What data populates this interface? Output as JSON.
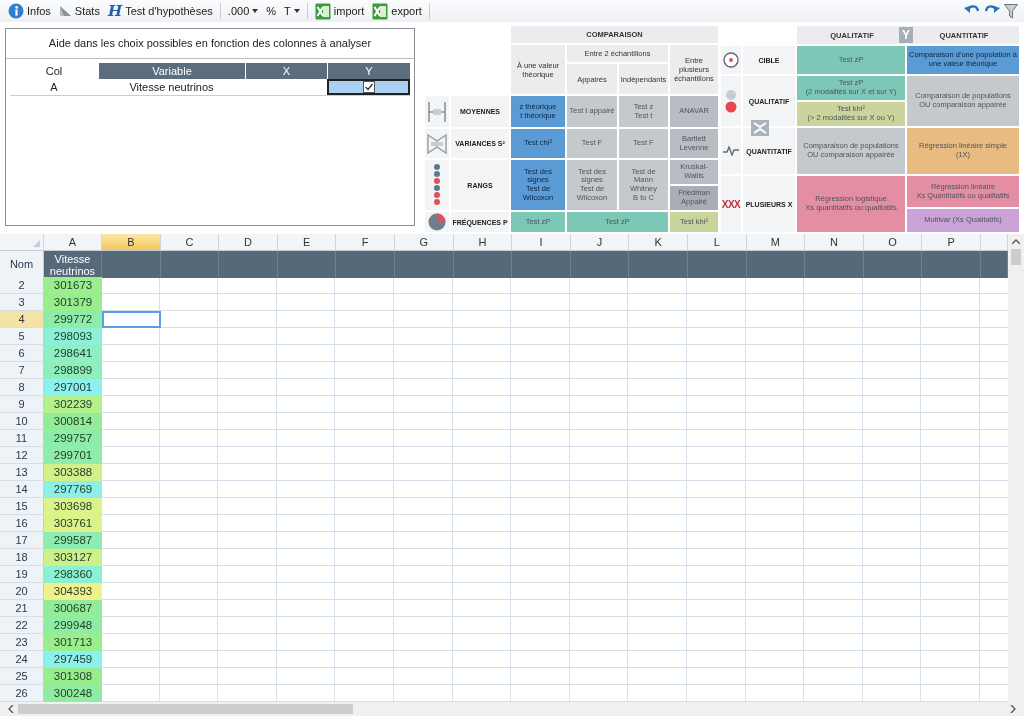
{
  "toolbar": {
    "groups": [
      {
        "items": [
          {
            "kind": "info",
            "label": "Infos"
          },
          {
            "kind": "stats",
            "label": "Stats"
          },
          {
            "kind": "hypothesis",
            "icon": "H",
            "label": "Test d'hypothèses"
          }
        ]
      },
      {
        "items": [
          {
            "kind": "dropdown",
            "label": ".000"
          },
          {
            "kind": "plain",
            "label": "%"
          },
          {
            "kind": "dropdown",
            "label": "T"
          }
        ]
      },
      {
        "items": [
          {
            "kind": "excel",
            "label": "import"
          },
          {
            "kind": "excel",
            "label": "export"
          }
        ]
      }
    ]
  },
  "help_panel": {
    "title": "Aide dans les choix possibles en fonction des colonnes à analyser",
    "columns": [
      "Col",
      "Variable",
      "X",
      "Y"
    ],
    "rows": [
      {
        "col": "A",
        "variable": "Vitesse neutrinos",
        "y_checked": true
      }
    ]
  },
  "comparison": {
    "title": "COMPARAISON",
    "single": "À une valeur\nthéorique",
    "two": "Entre 2 échantillons",
    "paired": "Appairés",
    "independent": "Indépendants",
    "several": "Entre\nplusieurs\néchantillons",
    "rows": [
      {
        "kind": "means",
        "label": "MOYENNES",
        "cells": [
          {
            "text": "z théorique\nt théorique",
            "color": "#5b9bd5",
            "active": true
          },
          {
            "text": "Test t appairé",
            "color": "#c5c8cd",
            "active": false
          },
          {
            "text": "Test z\nTest t",
            "color": "#c5c8cd",
            "active": false
          },
          {
            "text": "ANAVAR",
            "color": "#b9bdc3",
            "active": false
          }
        ]
      },
      {
        "kind": "variances",
        "label": "VARIANCES S²",
        "cells": [
          {
            "text": "Test chi²",
            "color": "#5b9bd5",
            "active": true
          },
          {
            "text": "Test F",
            "color": "#c5c8cd",
            "active": false
          },
          {
            "text": "Test F",
            "color": "#c5c8cd",
            "active": false
          },
          {
            "text": "Bartlett\nLevenne",
            "color": "#b9bdc3",
            "active": false
          }
        ]
      },
      {
        "kind": "ranks",
        "label": "RANGS",
        "cells": [
          {
            "text": "Test des signes\nTest de Wilcoxon",
            "color": "#5b9bd5",
            "active": true
          },
          {
            "text": "Test des signes\nTest de\nWilcoxon",
            "color": "#c5c8cd",
            "active": false
          },
          {
            "text": "Test de Mann\nWhitney\nB to C",
            "color": "#c5c8cd",
            "active": false
          },
          {
            "kind": "split",
            "parts": [
              {
                "text": "Kruskal-Wallis",
                "color": "#b9bdc3",
                "active": false
              },
              {
                "text": "Friedman\nAppairé",
                "color": "#a9aeb6",
                "active": false
              }
            ]
          }
        ]
      },
      {
        "kind": "frequencies",
        "label": "FRÉQUENCES P",
        "cells": [
          {
            "text": "Test zP",
            "color": "#7cc7b5",
            "active": false
          },
          {
            "colspan": 2,
            "text": "Test zP",
            "color": "#7cc7b5",
            "active": false
          },
          {
            "text": "Test khi²",
            "color": "#c9d59c",
            "active": false
          }
        ]
      }
    ]
  },
  "crosstab": {
    "qualitative": "QUALITATIF",
    "axis": "Y",
    "quantitative": "QUANTITATIF",
    "rows": [
      {
        "kind": "target",
        "label": "CIBLE",
        "cells": [
          {
            "text": "Test zP",
            "color": "#7cc7b5",
            "active": false
          },
          {
            "text": "Comparaison d'une population à une valeur théorique",
            "color": "#5b9bd5",
            "active": true
          }
        ]
      },
      {
        "kind": "qualitative",
        "label": "QUALITATIF",
        "cells": [
          {
            "kind": "split",
            "parts": [
              {
                "text": "Test zP\n(2 modalités sur X et sur Y)",
                "color": "#7cc7b5",
                "active": false
              },
              {
                "text": "Test khi²\n(> 2 modalités sur X ou Y)",
                "color": "#c9d59c",
                "active": false
              }
            ]
          },
          {
            "text": "Comparaison de populations\nOU comparaison appairée",
            "color": "#c5c8cd",
            "active": false
          }
        ]
      },
      {
        "kind": "quantitative",
        "label": "QUANTITATIF",
        "cells": [
          {
            "text": "Comparaison de populations\nOU comparaison appairée",
            "color": "#c5c8cd",
            "active": false
          },
          {
            "text": "Régression linéaire simple\n(1X)",
            "color": "#e8bc80",
            "active": false
          }
        ]
      },
      {
        "kind": "multiple",
        "symbol": "XXX",
        "label": "PLUSIEURS X",
        "cells": [
          {
            "text": "Régression logistique\nXs quantitatifs ou qualitatifs",
            "color": "#e38ea3",
            "active": false
          },
          {
            "kind": "split",
            "parts": [
              {
                "text": "Régression linéaire\nXs Quantitatifs ou qualitatifs",
                "color": "#e38ea3",
                "active": false
              },
              {
                "text": "Multivar (Xs Qualitatifs)",
                "color": "#cba3d8",
                "active": false
              }
            ]
          }
        ]
      }
    ]
  },
  "sheet": {
    "header_label": "Nom",
    "columns": [
      {
        "letter": "A",
        "name": "Vitesse neutrinos",
        "selected": false
      },
      {
        "letter": "B",
        "selected": true
      },
      {
        "letter": "C",
        "selected": false
      },
      {
        "letter": "D",
        "selected": false
      },
      {
        "letter": "E",
        "selected": false
      },
      {
        "letter": "F",
        "selected": false
      },
      {
        "letter": "G",
        "selected": false
      },
      {
        "letter": "H",
        "selected": false
      },
      {
        "letter": "I",
        "selected": false
      },
      {
        "letter": "J",
        "selected": false
      },
      {
        "letter": "K",
        "selected": false
      },
      {
        "letter": "L",
        "selected": false
      },
      {
        "letter": "M",
        "selected": false
      },
      {
        "letter": "N",
        "selected": false
      },
      {
        "letter": "O",
        "selected": false
      },
      {
        "letter": "P",
        "selected": false
      }
    ],
    "rows": [
      {
        "number": "2",
        "selected": false,
        "value": "301673",
        "color": "#9aee8c"
      },
      {
        "number": "3",
        "selected": false,
        "value": "301379",
        "color": "#98ee8e"
      },
      {
        "number": "4",
        "selected": true,
        "value": "299772",
        "color": "#8eecaa"
      },
      {
        "number": "5",
        "selected": false,
        "value": "298093",
        "color": "#8cf0d8"
      },
      {
        "number": "6",
        "selected": false,
        "value": "298641",
        "color": "#8eeec4"
      },
      {
        "number": "7",
        "selected": false,
        "value": "298899",
        "color": "#8eeebc"
      },
      {
        "number": "8",
        "selected": false,
        "value": "297001",
        "color": "#8cf0f0"
      },
      {
        "number": "9",
        "selected": false,
        "value": "302239",
        "color": "#b4f08c"
      },
      {
        "number": "10",
        "selected": false,
        "value": "300814",
        "color": "#92ec98"
      },
      {
        "number": "11",
        "selected": false,
        "value": "299757",
        "color": "#8eecaa"
      },
      {
        "number": "12",
        "selected": false,
        "value": "299701",
        "color": "#8eecac"
      },
      {
        "number": "13",
        "selected": false,
        "value": "303388",
        "color": "#d4f08a"
      },
      {
        "number": "14",
        "selected": false,
        "value": "297769",
        "color": "#8cf0e6"
      },
      {
        "number": "15",
        "selected": false,
        "value": "303698",
        "color": "#dcf28a"
      },
      {
        "number": "16",
        "selected": false,
        "value": "303761",
        "color": "#ddf28a"
      },
      {
        "number": "17",
        "selected": false,
        "value": "299587",
        "color": "#8eecb0"
      },
      {
        "number": "18",
        "selected": false,
        "value": "303127",
        "color": "#ccf08a"
      },
      {
        "number": "19",
        "selected": false,
        "value": "298360",
        "color": "#8cf0d2"
      },
      {
        "number": "20",
        "selected": false,
        "value": "304393",
        "color": "#f0f08c"
      },
      {
        "number": "21",
        "selected": false,
        "value": "300687",
        "color": "#92ec9a"
      },
      {
        "number": "22",
        "selected": false,
        "value": "299948",
        "color": "#8eeca4"
      },
      {
        "number": "23",
        "selected": false,
        "value": "301713",
        "color": "#9aee8c"
      },
      {
        "number": "24",
        "selected": false,
        "value": "297459",
        "color": "#8cf0ec"
      },
      {
        "number": "25",
        "selected": false,
        "value": "301308",
        "color": "#98ee8e"
      },
      {
        "number": "26",
        "selected": false,
        "value": "300248",
        "color": "#90eca0"
      }
    ]
  }
}
